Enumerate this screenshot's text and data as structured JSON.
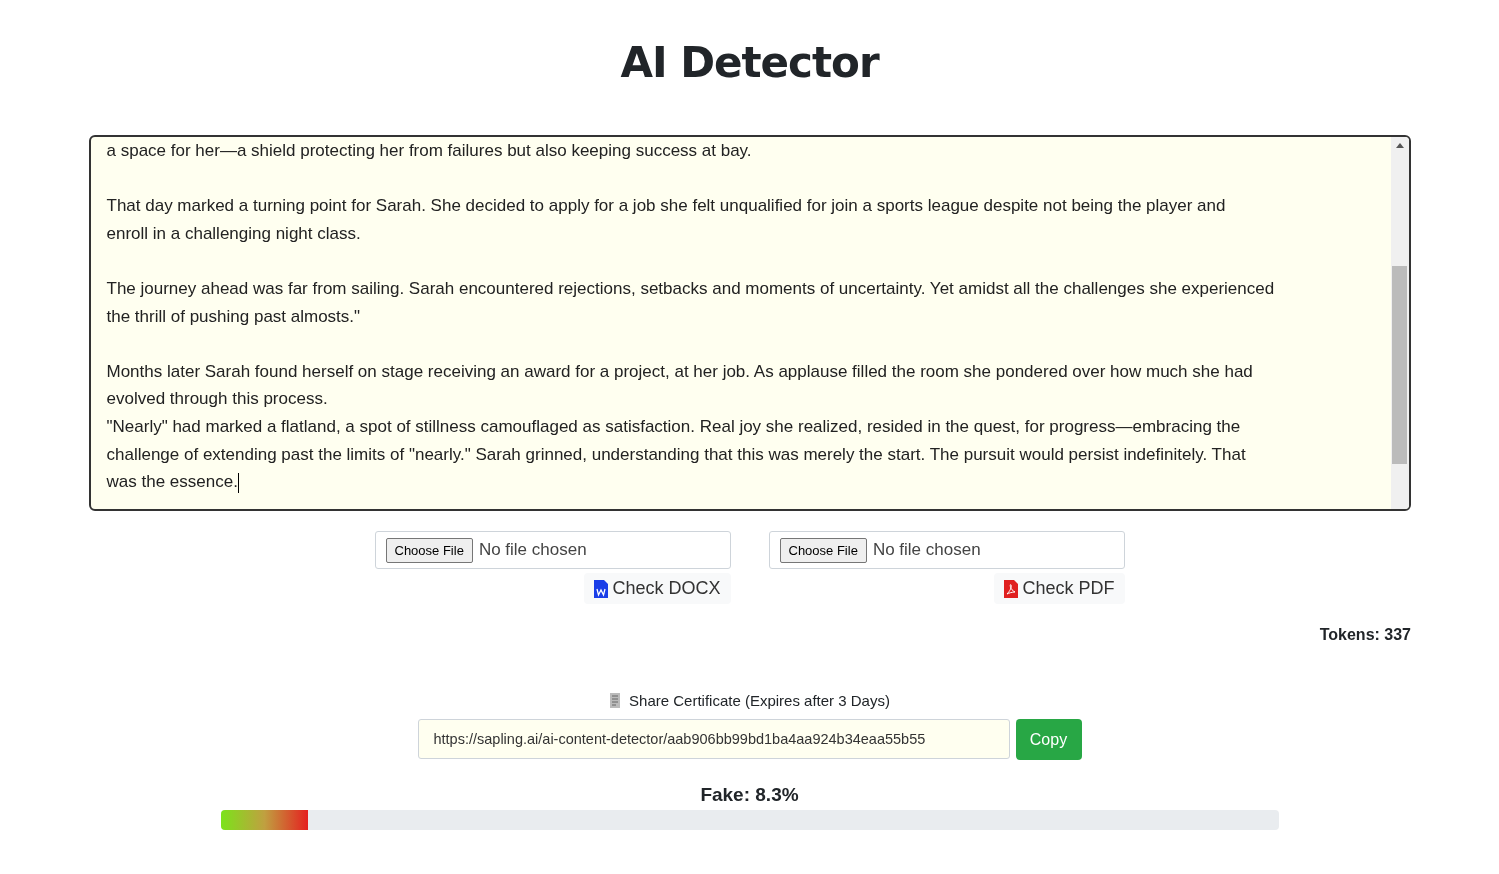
{
  "title": "AI Detector",
  "editor": {
    "paragraphs": [
      {
        "kind": "line",
        "lines": [
          "a space for her—a shield protecting her from failures but also keeping success at bay."
        ]
      },
      {
        "kind": "paragraph",
        "lines": [
          "That day marked a turning point for Sarah. She decided to apply for a job she felt unqualified for join a sports league despite not being the player and",
          "enroll in a challenging night class."
        ]
      },
      {
        "kind": "paragraph",
        "lines": [
          "The journey ahead was far from sailing. Sarah encountered rejections, setbacks and moments of uncertainty. Yet amidst all the challenges she experienced",
          "the thrill of pushing past almosts.\""
        ]
      },
      {
        "kind": "paragraph",
        "lines": [
          "Months later Sarah found herself on stage receiving an award for a project, at her job. As applause filled the room she pondered over how much she had",
          "evolved through this process."
        ]
      },
      {
        "kind": "line",
        "lines": [
          "\"Nearly\" had marked a flatland, a spot of stillness camouflaged as satisfaction. Real joy she realized, resided in the quest, for progress—embracing the",
          "challenge of extending past the limits of \"nearly.\" Sarah grinned, understanding that this was merely the start. The pursuit would persist indefinitely. That",
          "was the essence."
        ]
      }
    ]
  },
  "uploads": [
    {
      "kind": "docx",
      "choose_label": "Choose File",
      "status": "No file chosen",
      "check_label": "Check DOCX"
    },
    {
      "kind": "pdf",
      "choose_label": "Choose File",
      "status": "No file chosen",
      "check_label": "Check PDF"
    }
  ],
  "tokens": "Tokens: 337",
  "share": {
    "label": "Share Certificate (Expires after 3 Days)",
    "url": "https://sapling.ai/ai-content-detector/aab906bb99bd1ba4aa924b34eaa55b55",
    "copy_label": "Copy"
  },
  "result": {
    "label": "Fake: 8.3%",
    "level": 0.083
  }
}
